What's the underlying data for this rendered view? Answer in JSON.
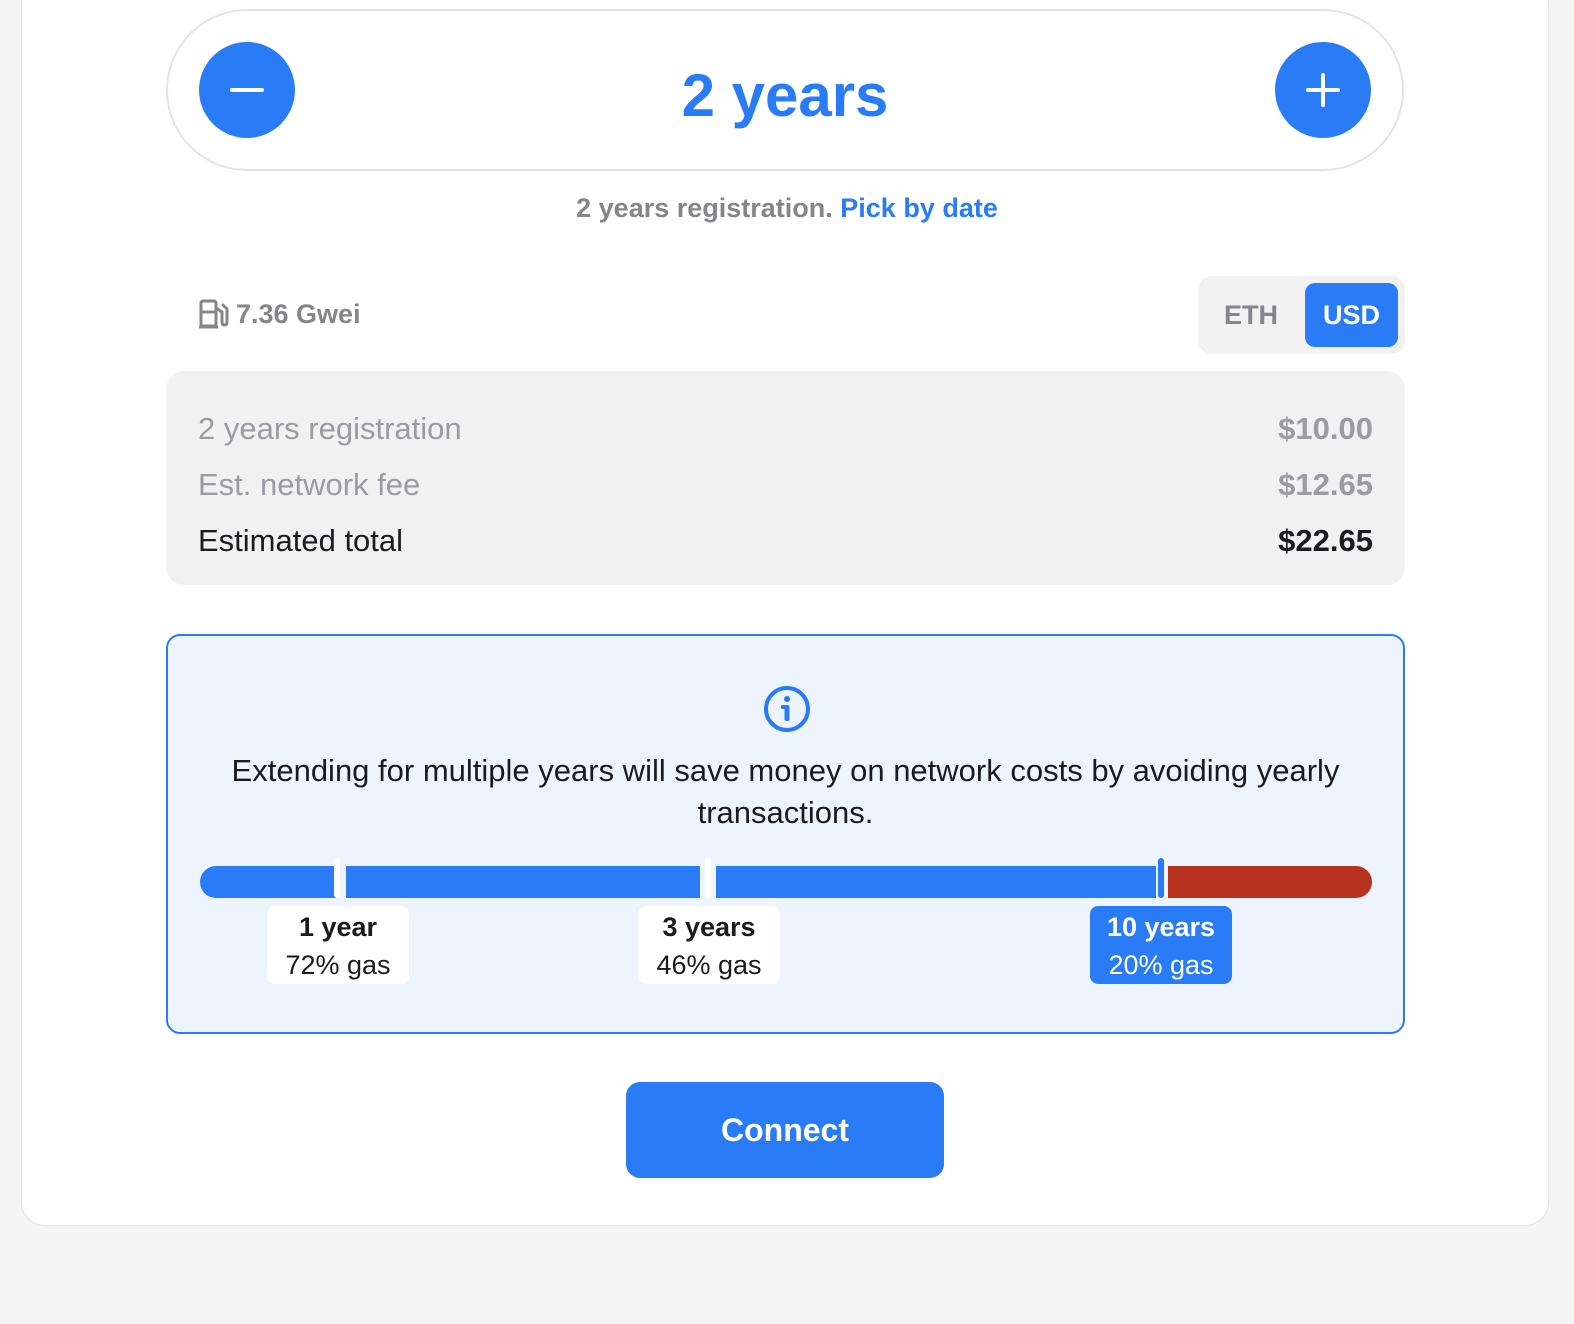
{
  "duration": {
    "value": "2 years",
    "subtitle": "2 years registration.",
    "pick_by_date": "Pick by date"
  },
  "gas": {
    "icon": "gas-pump-icon",
    "price": "7.36 Gwei"
  },
  "currency_toggle": {
    "options": [
      "ETH",
      "USD"
    ],
    "selected": "USD"
  },
  "costs": {
    "rows": [
      {
        "label": "2 years registration",
        "value": "$10.00"
      },
      {
        "label": "Est. network fee",
        "value": "$12.65"
      },
      {
        "label": "Estimated total",
        "value": "$22.65"
      }
    ]
  },
  "info": {
    "icon": "info-icon",
    "message": "Extending for multiple years will save money on network costs by avoiding yearly transactions.",
    "markers": [
      {
        "years": "1 year",
        "gas": "72% gas"
      },
      {
        "years": "3 years",
        "gas": "46% gas"
      },
      {
        "years": "10 years",
        "gas": "20% gas",
        "active": true
      }
    ]
  },
  "actions": {
    "connect_label": "Connect"
  },
  "colors": {
    "accent": "#2a7cf6",
    "danger": "#b83220",
    "muted": "#85858c"
  }
}
